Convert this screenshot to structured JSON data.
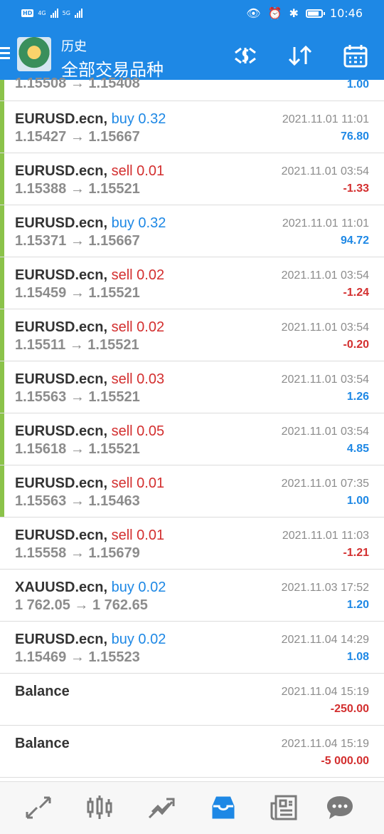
{
  "status_bar": {
    "time": "10:46",
    "network_left": "4G",
    "network_right": "5G",
    "hd_label": "HD"
  },
  "header": {
    "title": "历史",
    "subtitle": "全部交易品种"
  },
  "colors": {
    "brand_blue": "#1e88e5",
    "sell_red": "#d32f2f",
    "marker_green": "#8bc34a"
  },
  "partial_row": {
    "prices": "1.15508 → 1.15408",
    "profit": "1.00"
  },
  "rows": [
    {
      "symbol": "EURUSD.ecn,",
      "action": "buy 0.32",
      "prices": "1.15427 → 1.15667",
      "time": "2021.11.01 11:01",
      "profit": "76.80"
    },
    {
      "symbol": "EURUSD.ecn,",
      "action": "sell 0.01",
      "prices": "1.15388 → 1.15521",
      "time": "2021.11.01 03:54",
      "profit": "-1.33"
    },
    {
      "symbol": "EURUSD.ecn,",
      "action": "buy 0.32",
      "prices": "1.15371 → 1.15667",
      "time": "2021.11.01 11:01",
      "profit": "94.72"
    },
    {
      "symbol": "EURUSD.ecn,",
      "action": "sell 0.02",
      "prices": "1.15459 → 1.15521",
      "time": "2021.11.01 03:54",
      "profit": "-1.24"
    },
    {
      "symbol": "EURUSD.ecn,",
      "action": "sell 0.02",
      "prices": "1.15511 → 1.15521",
      "time": "2021.11.01 03:54",
      "profit": "-0.20"
    },
    {
      "symbol": "EURUSD.ecn,",
      "action": "sell 0.03",
      "prices": "1.15563 → 1.15521",
      "time": "2021.11.01 03:54",
      "profit": "1.26"
    },
    {
      "symbol": "EURUSD.ecn,",
      "action": "sell 0.05",
      "prices": "1.15618 → 1.15521",
      "time": "2021.11.01 03:54",
      "profit": "4.85"
    },
    {
      "symbol": "EURUSD.ecn,",
      "action": "sell 0.01",
      "prices": "1.15563 → 1.15463",
      "time": "2021.11.01 07:35",
      "profit": "1.00"
    },
    {
      "symbol": "EURUSD.ecn,",
      "action": "sell 0.01",
      "prices": "1.15558 → 1.15679",
      "time": "2021.11.01 11:03",
      "profit": "-1.21"
    },
    {
      "symbol": "XAUUSD.ecn,",
      "action": "buy 0.02",
      "prices": "1 762.05 → 1 762.65",
      "time": "2021.11.03 17:52",
      "profit": "1.20"
    },
    {
      "symbol": "EURUSD.ecn,",
      "action": "buy 0.02",
      "prices": "1.15469 → 1.15523",
      "time": "2021.11.04 14:29",
      "profit": "1.08"
    },
    {
      "symbol": "Balance",
      "action": "",
      "prices": "",
      "time": "2021.11.04 15:19",
      "profit": "-250.00"
    },
    {
      "symbol": "Balance",
      "action": "",
      "prices": "",
      "time": "2021.11.04 15:19",
      "profit": "-5 000.00"
    }
  ],
  "toolbar_icons": [
    "currency-exchange-icon",
    "sort-icon",
    "calendar-icon"
  ],
  "bottom_nav": [
    "quotes-icon",
    "chart-icon",
    "trade-icon",
    "history-icon",
    "news-icon",
    "chat-icon"
  ],
  "bottom_nav_active": "history-icon"
}
